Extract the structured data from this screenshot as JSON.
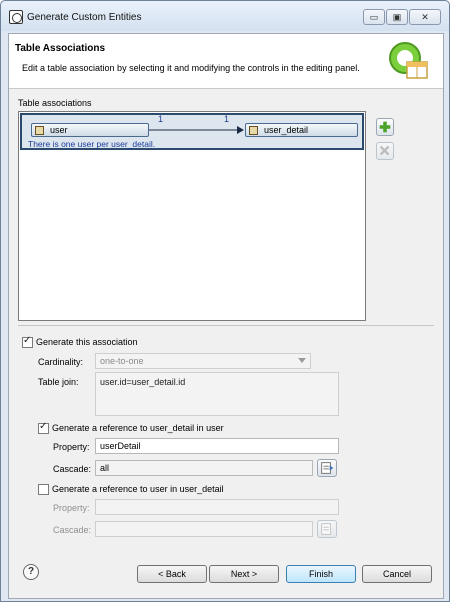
{
  "window": {
    "title": "Generate Custom Entities",
    "btn_min": "▭",
    "btn_max": "▣",
    "btn_close": "✕"
  },
  "banner": {
    "title": "Table Associations",
    "description": "Edit a table association by selecting it and modifying the controls in the editing panel.",
    "icon": "wizard-banner-icon"
  },
  "associations": {
    "label": "Table associations",
    "label_mnemonic": "a",
    "items": [
      {
        "source": "user",
        "target": "user_detail",
        "source_cardinality": "1",
        "target_cardinality": "1",
        "description": "There is one user per user_detail."
      }
    ],
    "add_icon": "add-icon",
    "remove_icon": "delete-icon"
  },
  "editor": {
    "generate_association_label": "Generate this association",
    "generate_association_checked": true,
    "cardinality_label": "Cardinality:",
    "cardinality_value": "one-to-one",
    "table_join_label": "Table join:",
    "table_join_value": "user.id=user_detail.id",
    "ref1": {
      "label": "Generate a reference to user_detail in user",
      "checked": true,
      "property_label": "Property:",
      "property_value": "userDetail",
      "cascade_label": "Cascade:",
      "cascade_value": "all"
    },
    "ref2": {
      "label": "Generate a reference to user in user_detail",
      "checked": false,
      "property_label": "Property:",
      "property_value": "",
      "cascade_label": "Cascade:",
      "cascade_value": ""
    }
  },
  "footer": {
    "help": "?",
    "back": "< Back",
    "next": "Next >",
    "finish": "Finish",
    "cancel": "Cancel"
  }
}
